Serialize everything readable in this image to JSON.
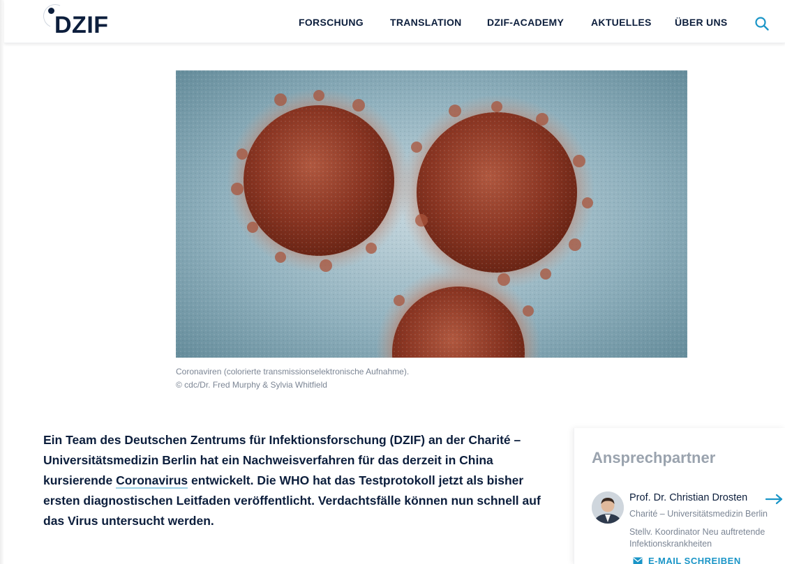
{
  "brand": {
    "logo_text": "DZIF"
  },
  "nav": {
    "items": [
      {
        "label": "FORSCHUNG"
      },
      {
        "label": "TRANSLATION"
      },
      {
        "label": "DZIF-ACADEMY"
      },
      {
        "label": "AKTUELLES"
      },
      {
        "label": "ÜBER UNS"
      }
    ],
    "search_icon": "search-icon"
  },
  "hero": {
    "caption_line1": "Coronaviren (colorierte transmissionselektronische Aufnahme).",
    "caption_line2": "© cdc/Dr. Fred Murphy & Sylvia Whitfield"
  },
  "article": {
    "lead_part1": "Ein Team des Deutschen Zentrums für Infektionsforschung (DZIF) an der Charité – Universitätsmedizin Berlin hat ein Nachweisverfahren für das derzeit in China kursierende ",
    "lead_link": "Coronavirus",
    "lead_part2": " entwickelt. Die WHO hat das Testprotokoll jetzt als bisher ersten diagnostischen Leitfaden veröffentlicht. Verdachtsfälle können nun schnell auf das Virus untersucht werden."
  },
  "contact": {
    "title": "Ansprechpartner",
    "name": "Prof. Dr. Christian Drosten",
    "institution": "Charité – Universitätsmedizin Berlin",
    "role": "Stellv. Koordinator Neu auftretende Infektionskrankheiten",
    "email_label": "E-MAIL SCHREIBEN"
  },
  "colors": {
    "brand_navy": "#0c1e3c",
    "accent_blue": "#1a95c7",
    "muted_gray": "#7b8594"
  }
}
